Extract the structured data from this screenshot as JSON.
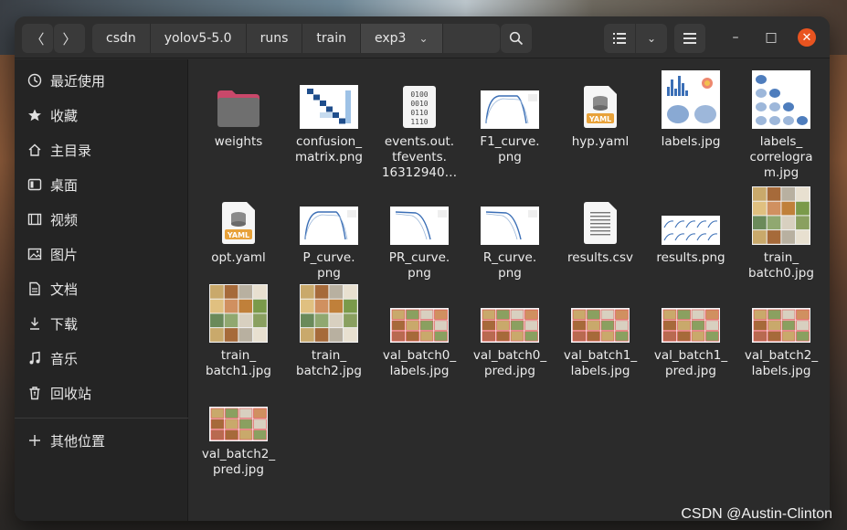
{
  "nav": {
    "back": "〈",
    "forward": "〉"
  },
  "breadcrumbs": [
    "csdn",
    "yolov5-5.0",
    "runs",
    "train",
    "exp3"
  ],
  "toolbar": {
    "search_icon": "search-icon",
    "view_list_icon": "list-view-icon",
    "view_options_icon": "chevron-down-icon",
    "menu_icon": "hamburger-icon"
  },
  "window_controls": {
    "minimize": "–",
    "maximize": "□",
    "close": "✕"
  },
  "sidebar": {
    "items": [
      {
        "label": "最近使用",
        "icon": "clock-icon"
      },
      {
        "label": "收藏",
        "icon": "star-icon"
      },
      {
        "label": "主目录",
        "icon": "home-icon"
      },
      {
        "label": "桌面",
        "icon": "desktop-icon"
      },
      {
        "label": "视频",
        "icon": "film-icon"
      },
      {
        "label": "图片",
        "icon": "image-icon"
      },
      {
        "label": "文档",
        "icon": "document-icon"
      },
      {
        "label": "下载",
        "icon": "download-icon"
      },
      {
        "label": "音乐",
        "icon": "music-icon"
      },
      {
        "label": "回收站",
        "icon": "trash-icon"
      }
    ],
    "other": {
      "label": "其他位置",
      "icon": "plus-icon"
    }
  },
  "files": [
    {
      "name": "weights",
      "type": "folder"
    },
    {
      "name": "confusion_\nmatrix.png",
      "type": "matrix"
    },
    {
      "name": "events.out.\ntfevents.\n16312940…",
      "type": "binary",
      "glyph": "0100\n0010\n0110\n1110"
    },
    {
      "name": "F1_curve.\npng",
      "type": "curve"
    },
    {
      "name": "hyp.yaml",
      "type": "yaml",
      "badge": "YAML"
    },
    {
      "name": "labels.jpg",
      "type": "labels"
    },
    {
      "name": "labels_\ncorrelogra\nm.jpg",
      "type": "correlogram"
    },
    {
      "name": "opt.yaml",
      "type": "yaml",
      "badge": "YAML"
    },
    {
      "name": "P_curve.\npng",
      "type": "curve"
    },
    {
      "name": "PR_curve.\npng",
      "type": "curve-down"
    },
    {
      "name": "R_curve.\npng",
      "type": "curve-down"
    },
    {
      "name": "results.csv",
      "type": "text"
    },
    {
      "name": "results.png",
      "type": "results"
    },
    {
      "name": "train_\nbatch0.jpg",
      "type": "photo"
    },
    {
      "name": "train_\nbatch1.jpg",
      "type": "photo"
    },
    {
      "name": "train_\nbatch2.jpg",
      "type": "photo"
    },
    {
      "name": "val_batch0_\nlabels.jpg",
      "type": "wide"
    },
    {
      "name": "val_batch0_\npred.jpg",
      "type": "wide"
    },
    {
      "name": "val_batch1_\nlabels.jpg",
      "type": "wide"
    },
    {
      "name": "val_batch1_\npred.jpg",
      "type": "wide"
    },
    {
      "name": "val_batch2_\nlabels.jpg",
      "type": "wide"
    },
    {
      "name": "val_batch2_\npred.jpg",
      "type": "wide"
    }
  ],
  "colors": {
    "accent": "#e95420",
    "folder": "#6f6f6f",
    "folder_tab": "#c9486a",
    "chart_blue": "#3b6fb6"
  },
  "watermark": "CSDN @Austin-Clinton"
}
